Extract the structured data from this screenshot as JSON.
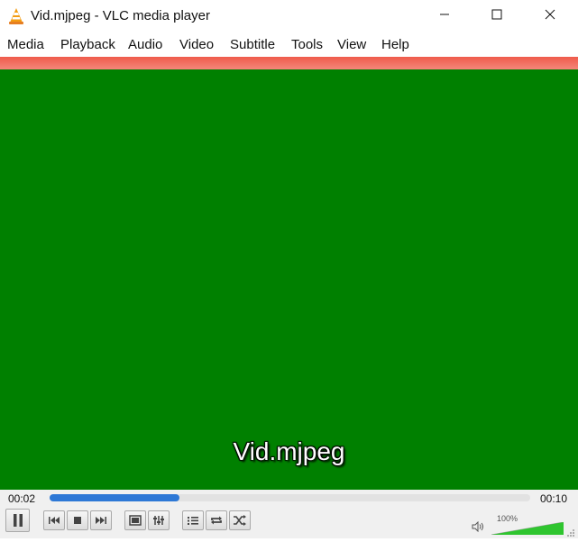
{
  "window": {
    "title": "Vid.mjpeg - VLC media player",
    "icon": "vlc-cone-icon",
    "buttons": [
      "minimize-icon",
      "maximize-icon",
      "close-icon"
    ]
  },
  "menu": [
    {
      "label": "Media"
    },
    {
      "label": "Playback"
    },
    {
      "label": "Audio"
    },
    {
      "label": "Video"
    },
    {
      "label": "Subtitle"
    },
    {
      "label": "Tools"
    },
    {
      "label": "View"
    },
    {
      "label": "Help"
    }
  ],
  "video": {
    "background_color": "#008000",
    "osd_title": "Vid.mjpeg"
  },
  "playback": {
    "elapsed": "00:02",
    "total": "00:10",
    "progress": 0.27
  },
  "controls": {
    "buttons": [
      "pause-icon",
      "previous-icon",
      "stop-icon",
      "next-icon",
      "fullscreen-icon",
      "extended-settings-icon",
      "playlist-icon",
      "loop-icon",
      "shuffle-icon"
    ]
  },
  "volume": {
    "percent_label": "100%",
    "level": 1.0,
    "icon": "speaker-icon"
  },
  "colors": {
    "accent_strip": "#ef5b4b",
    "seek_fill": "#2d78d6",
    "volume_fill": "#2fc52f"
  }
}
